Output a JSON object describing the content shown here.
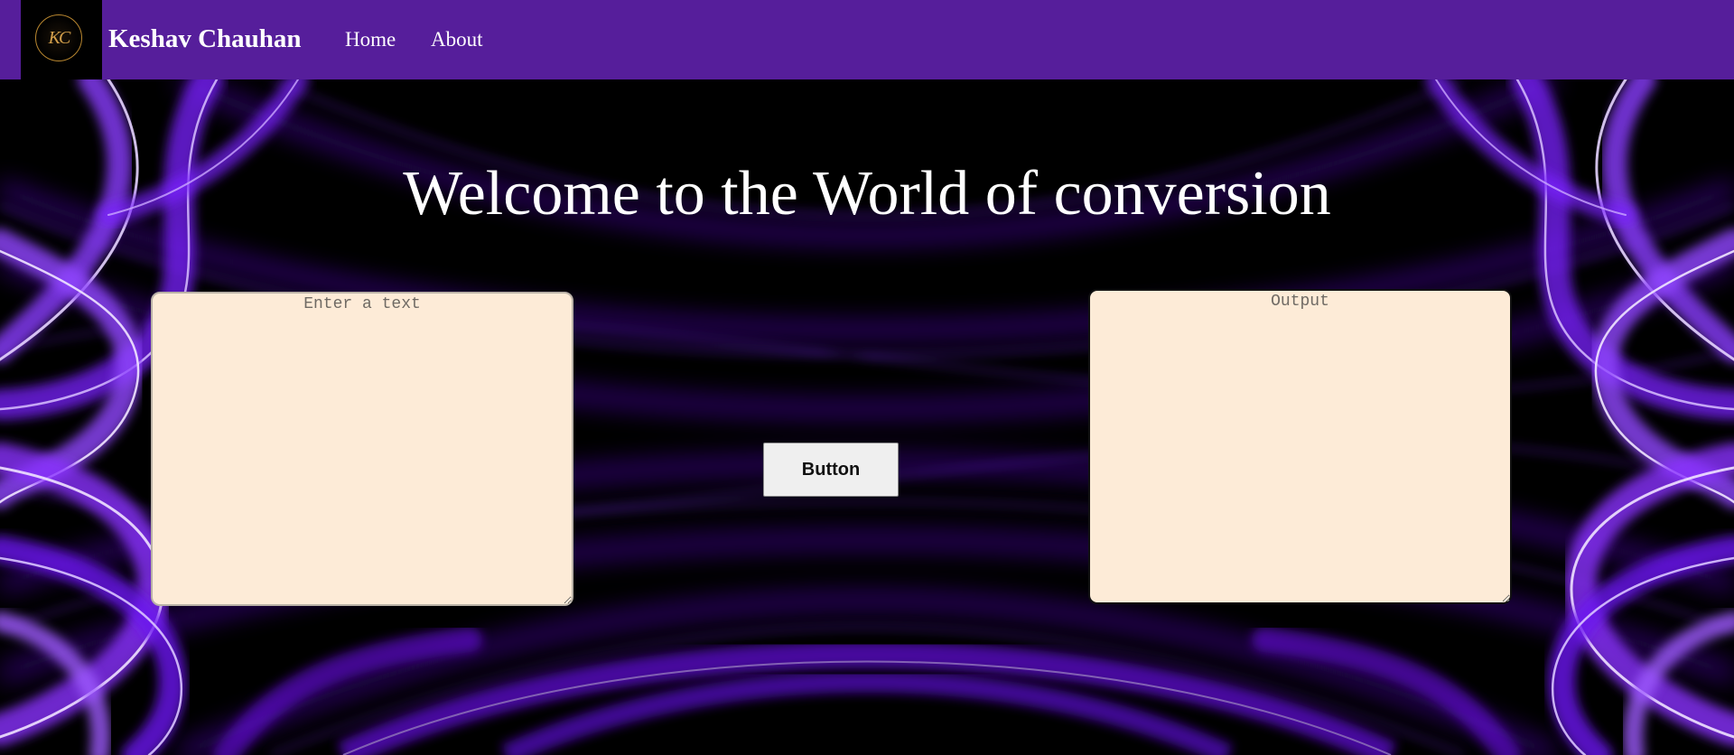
{
  "navbar": {
    "brand": "Keshav Chauhan",
    "links": [
      {
        "label": "Home"
      },
      {
        "label": "About"
      }
    ],
    "background_color": "#561e9b",
    "logo": {
      "monogram": "KC",
      "icon": "kc-monogram-logo"
    }
  },
  "main": {
    "title": "Welcome to the World of conversion",
    "input": {
      "placeholder": "Enter a text",
      "value": ""
    },
    "button": {
      "label": "Button"
    },
    "output": {
      "placeholder": "Output",
      "value": ""
    },
    "textarea_color": "#fdebd7"
  },
  "background": {
    "description_icon": "purple-light-waves-background",
    "colors": [
      "#000000",
      "#6a10e6",
      "#9b5cff"
    ]
  }
}
